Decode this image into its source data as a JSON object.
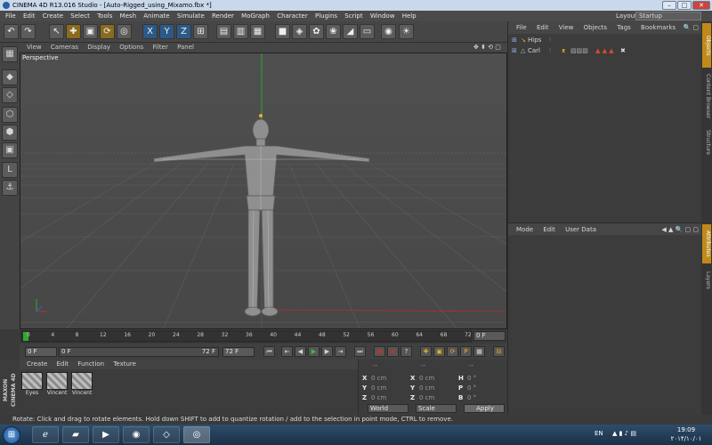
{
  "window": {
    "title": "CINEMA 4D R13.016 Studio - [Auto-Rigged_using_Mixamo.fbx *]"
  },
  "menubar": {
    "items": [
      "File",
      "Edit",
      "Create",
      "Select",
      "Tools",
      "Mesh",
      "Animate",
      "Simulate",
      "Render",
      "MoGraph",
      "Character",
      "Plugins",
      "Script",
      "Window",
      "Help"
    ],
    "layout_label": "Layout:",
    "layout_value": "Startup"
  },
  "toolbar": {
    "icons": [
      "undo-icon",
      "redo-icon",
      "live-select-icon",
      "move-icon",
      "scale-icon",
      "rotate-icon",
      "recent-tool-icon",
      "x-axis-icon",
      "y-axis-icon",
      "z-axis-icon",
      "coordinate-system-icon",
      "render-view-icon",
      "render-picture-viewer-icon",
      "edit-render-settings-icon",
      "cube-icon",
      "subdivision-icon",
      "array-icon",
      "metaball-icon",
      "deformer-icon",
      "floor-icon",
      "camera-icon",
      "light-icon"
    ],
    "x": "X",
    "y": "Y",
    "z": "Z"
  },
  "viewport": {
    "menu": [
      "View",
      "Cameras",
      "Display",
      "Options",
      "Filter",
      "Panel"
    ],
    "label": "Perspective"
  },
  "timeline": {
    "ticks": [
      "0",
      "4",
      "8",
      "12",
      "16",
      "20",
      "24",
      "28",
      "32",
      "36",
      "40",
      "44",
      "48",
      "52",
      "56",
      "60",
      "64",
      "68",
      "72"
    ],
    "current_frame": "0 F"
  },
  "transport": {
    "start": "0 F",
    "range_start": "0 F",
    "range_end": "72 F",
    "end": "72 F"
  },
  "materials": {
    "menu": [
      "Create",
      "Edit",
      "Function",
      "Texture"
    ],
    "items": [
      "Eyes",
      "Vincent",
      "Vincent"
    ],
    "logo_line1": "MAXON",
    "logo_line2": "CINEMA 4D"
  },
  "coords": {
    "header": [
      "--",
      "--",
      "--"
    ],
    "rows": [
      {
        "a": "X",
        "av": "0 cm",
        "b": "X",
        "bv": "0 cm",
        "c": "H",
        "cv": "0 °"
      },
      {
        "a": "Y",
        "av": "0 cm",
        "b": "Y",
        "bv": "0 cm",
        "c": "P",
        "cv": "0 °"
      },
      {
        "a": "Z",
        "av": "0 cm",
        "b": "Z",
        "bv": "0 cm",
        "c": "B",
        "cv": "0 °"
      }
    ],
    "mode1": "World",
    "mode2": "Scale",
    "apply": "Apply"
  },
  "objects": {
    "menu": [
      "File",
      "Edit",
      "View",
      "Objects",
      "Tags",
      "Bookmarks"
    ],
    "rows": [
      "Hips",
      "Carl"
    ]
  },
  "attributes": {
    "menu": [
      "Mode",
      "Edit",
      "User Data"
    ]
  },
  "sidetabs": [
    "Objects",
    "Content Browser",
    "Structure",
    "Attributes",
    "Layers"
  ],
  "status": {
    "text": "Rotate: Click and drag to rotate elements. Hold down SHIFT to add to quantize rotation / add to the selection in point mode, CTRL to remove."
  },
  "taskbar": {
    "lang": "EN",
    "time": "19:09",
    "date": "۲۰۱۴/۱۰/۰۱"
  },
  "colors": {
    "accent": "#e8b020",
    "axis_y": "#2ea82e",
    "axis_x": "#b03030"
  }
}
